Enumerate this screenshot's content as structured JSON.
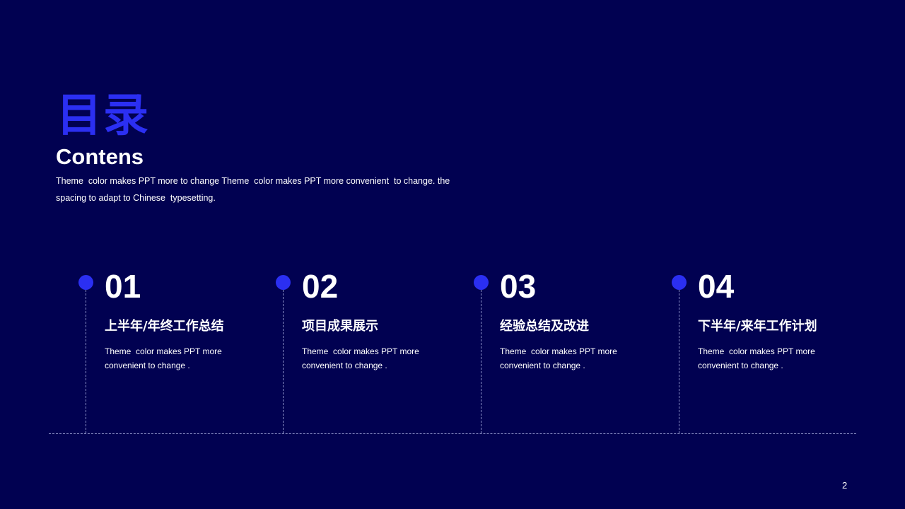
{
  "title": {
    "cn": "目录",
    "en": "Contens"
  },
  "intro": "Theme  color makes PPT more to change Theme  color makes PPT more convenient  to change. the spacing to adapt to Chinese  typesetting.",
  "items": [
    {
      "num": "01",
      "heading": "上半年/年终工作总结",
      "desc": "Theme  color makes PPT more convenient to change ."
    },
    {
      "num": "02",
      "heading": "项目成果展示",
      "desc": "Theme  color makes PPT more convenient to change ."
    },
    {
      "num": "03",
      "heading": "经验总结及改进",
      "desc": "Theme  color makes PPT more convenient to change ."
    },
    {
      "num": "04",
      "heading": "下半年/来年工作计划",
      "desc": "Theme  color makes PPT more convenient to change ."
    }
  ],
  "page_number": "2",
  "colors": {
    "background": "#010151",
    "accent": "#2b2ff2",
    "text": "#ffffff",
    "dashed_line": "#8a8fc6"
  }
}
